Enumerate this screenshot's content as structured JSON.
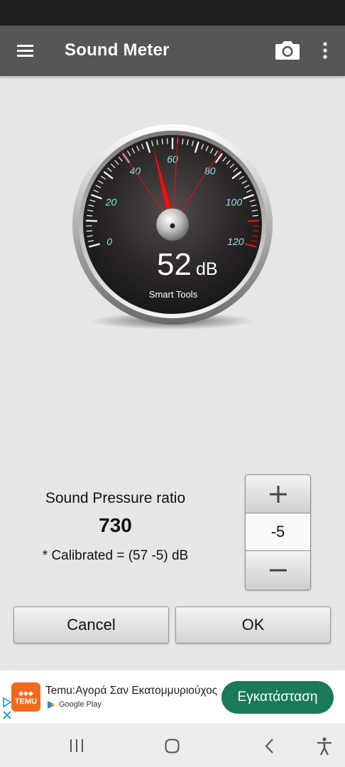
{
  "app_bar": {
    "title": "Sound Meter",
    "icons": [
      "menu-icon",
      "camera-icon",
      "more-vert-icon"
    ]
  },
  "gauge": {
    "scale_labels": [
      "0",
      "20",
      "40",
      "60",
      "80",
      "100",
      "120"
    ],
    "scale_min": 0,
    "scale_max": 120,
    "needle_value": 52,
    "reading_value": "52",
    "reading_unit": "dB",
    "brand": "Smart Tools",
    "accent_color": "#e01515",
    "label_color": "#8fe3ea"
  },
  "calibration": {
    "title": "Sound Pressure ratio",
    "value": "730",
    "note": "* Calibrated = (57 -5) dB",
    "stepper_value": "-5",
    "plus_icon": "plus-icon",
    "minus_icon": "minus-icon"
  },
  "buttons": {
    "cancel": "Cancel",
    "ok": "OK"
  },
  "ad": {
    "logo_text": "TEMU",
    "title": "Temu:Αγορά Σαν Εκατομμυριούχος",
    "store": "Google Play",
    "cta": "Εγκατάσταση",
    "cta_color": "#1a7a57"
  },
  "nav": {
    "icons": [
      "recents-icon",
      "home-icon",
      "back-icon",
      "accessibility-icon"
    ]
  }
}
